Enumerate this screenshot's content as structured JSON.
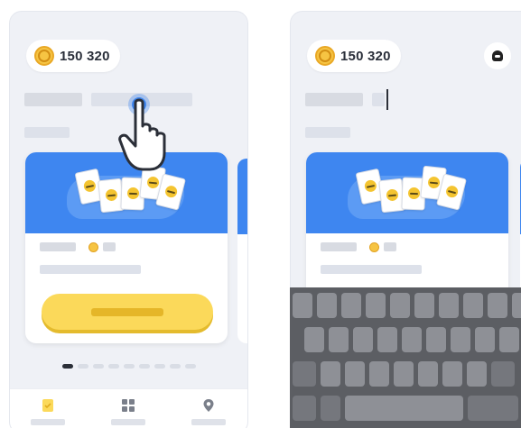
{
  "left_screen": {
    "coins": {
      "value": "150 320",
      "icon": "coin-icon"
    },
    "tap_hint_icon": "hand-pointer-icon",
    "card": {
      "banner_icon": "emoji-cards-icon",
      "cta_icon": "yellow-button"
    },
    "pager": {
      "count": 9,
      "active_index": 0
    },
    "tabs": [
      {
        "icon": "cards-tab-icon",
        "active": true
      },
      {
        "icon": "grid-tab-icon",
        "active": false
      },
      {
        "icon": "location-pin-icon",
        "active": false
      }
    ]
  },
  "right_screen": {
    "coins": {
      "value": "150 320",
      "icon": "coin-icon"
    },
    "profile_icon": "profile-icon",
    "keyboard_icon": "keyboard"
  },
  "colors": {
    "accent_blue": "#3e86f0",
    "button_yellow": "#fbd95a",
    "coin_gold": "#f6c443"
  }
}
